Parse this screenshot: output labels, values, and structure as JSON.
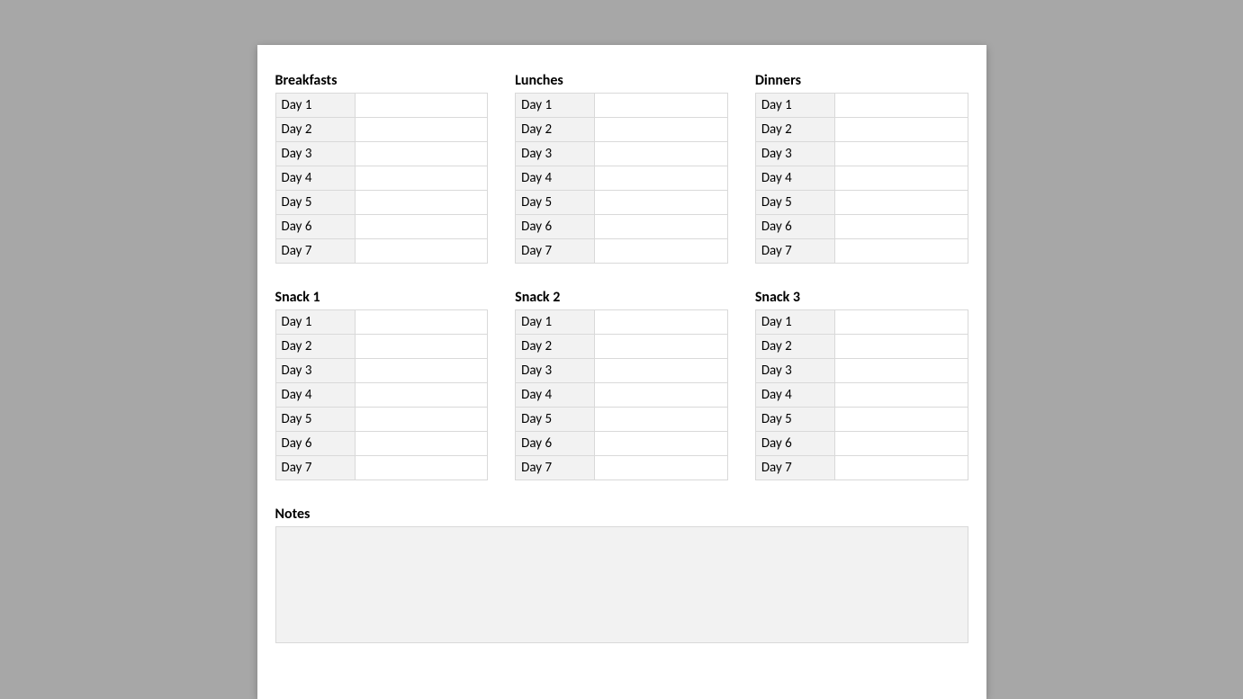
{
  "sections": [
    {
      "title": "Breakfasts",
      "rows": [
        {
          "label": "Day 1",
          "value": ""
        },
        {
          "label": "Day 2",
          "value": ""
        },
        {
          "label": "Day 3",
          "value": ""
        },
        {
          "label": "Day 4",
          "value": ""
        },
        {
          "label": "Day 5",
          "value": ""
        },
        {
          "label": "Day 6",
          "value": ""
        },
        {
          "label": "Day 7",
          "value": ""
        }
      ]
    },
    {
      "title": "Lunches",
      "rows": [
        {
          "label": "Day 1",
          "value": ""
        },
        {
          "label": "Day 2",
          "value": ""
        },
        {
          "label": "Day 3",
          "value": ""
        },
        {
          "label": "Day 4",
          "value": ""
        },
        {
          "label": "Day 5",
          "value": ""
        },
        {
          "label": "Day 6",
          "value": ""
        },
        {
          "label": "Day 7",
          "value": ""
        }
      ]
    },
    {
      "title": "Dinners",
      "rows": [
        {
          "label": "Day 1",
          "value": ""
        },
        {
          "label": "Day 2",
          "value": ""
        },
        {
          "label": "Day 3",
          "value": ""
        },
        {
          "label": "Day 4",
          "value": ""
        },
        {
          "label": "Day 5",
          "value": ""
        },
        {
          "label": "Day 6",
          "value": ""
        },
        {
          "label": "Day 7",
          "value": ""
        }
      ]
    },
    {
      "title": "Snack 1",
      "rows": [
        {
          "label": "Day 1",
          "value": ""
        },
        {
          "label": "Day 2",
          "value": ""
        },
        {
          "label": "Day 3",
          "value": ""
        },
        {
          "label": "Day 4",
          "value": ""
        },
        {
          "label": "Day 5",
          "value": ""
        },
        {
          "label": "Day 6",
          "value": ""
        },
        {
          "label": "Day 7",
          "value": ""
        }
      ]
    },
    {
      "title": "Snack 2",
      "rows": [
        {
          "label": "Day 1",
          "value": ""
        },
        {
          "label": "Day 2",
          "value": ""
        },
        {
          "label": "Day 3",
          "value": ""
        },
        {
          "label": "Day 4",
          "value": ""
        },
        {
          "label": "Day 5",
          "value": ""
        },
        {
          "label": "Day 6",
          "value": ""
        },
        {
          "label": "Day 7",
          "value": ""
        }
      ]
    },
    {
      "title": "Snack 3",
      "rows": [
        {
          "label": "Day 1",
          "value": ""
        },
        {
          "label": "Day 2",
          "value": ""
        },
        {
          "label": "Day 3",
          "value": ""
        },
        {
          "label": "Day 4",
          "value": ""
        },
        {
          "label": "Day 5",
          "value": ""
        },
        {
          "label": "Day 6",
          "value": ""
        },
        {
          "label": "Day 7",
          "value": ""
        }
      ]
    }
  ],
  "notes": {
    "title": "Notes",
    "value": ""
  }
}
